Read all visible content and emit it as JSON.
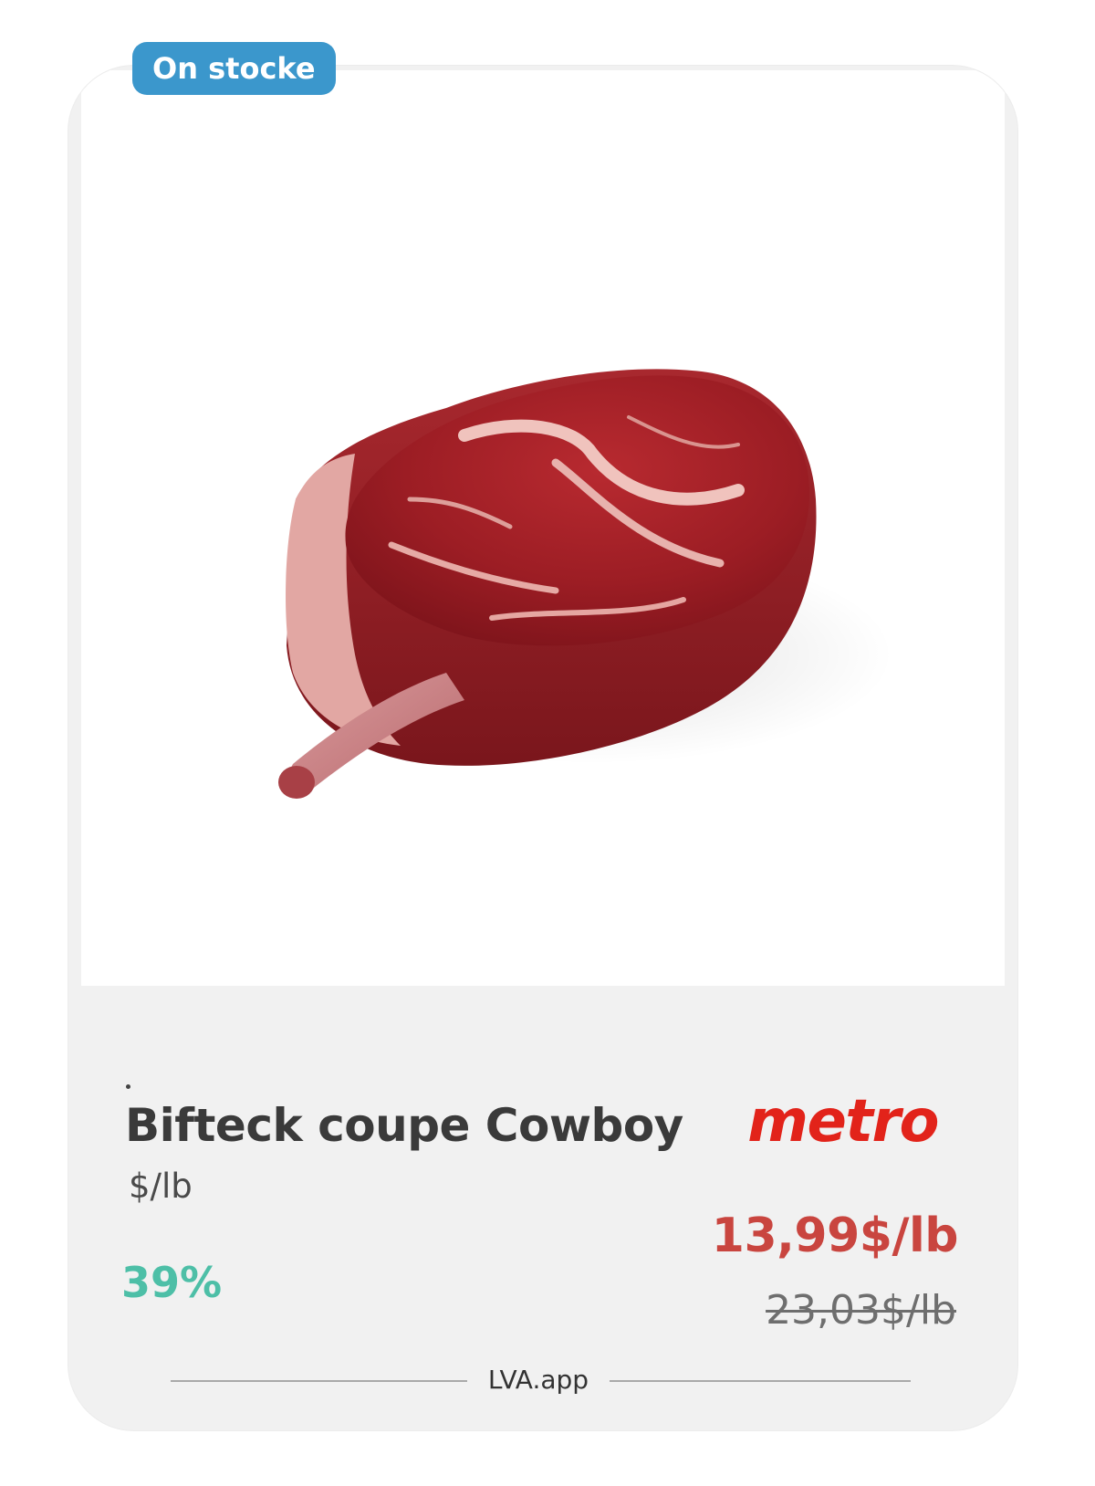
{
  "badge": {
    "label": "On stocke",
    "color": "#3b97cc"
  },
  "product": {
    "image": "cowboy-steak-photo",
    "name": "Bifteck coupe Cowboy",
    "unit": "$/lb",
    "discount": "39%",
    "price": "13,99$/lb",
    "old_price": "23,03$/lb"
  },
  "store": {
    "name": "metro",
    "color": "#e2231a"
  },
  "footer": {
    "text": "LVA.app"
  },
  "colors": {
    "discount": "#4dbfa7",
    "price": "#c9453f",
    "card_bg": "#f1f1f1"
  }
}
